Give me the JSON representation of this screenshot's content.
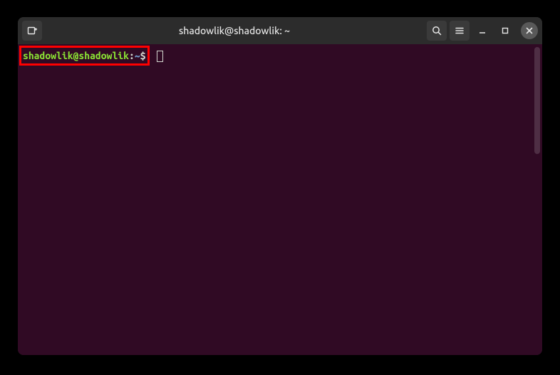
{
  "window": {
    "title": "shadowlik@shadowlik: ~"
  },
  "prompt": {
    "user_host": "shadowlik@shadowlik",
    "colon": ":",
    "path": "~",
    "symbol": "$"
  }
}
